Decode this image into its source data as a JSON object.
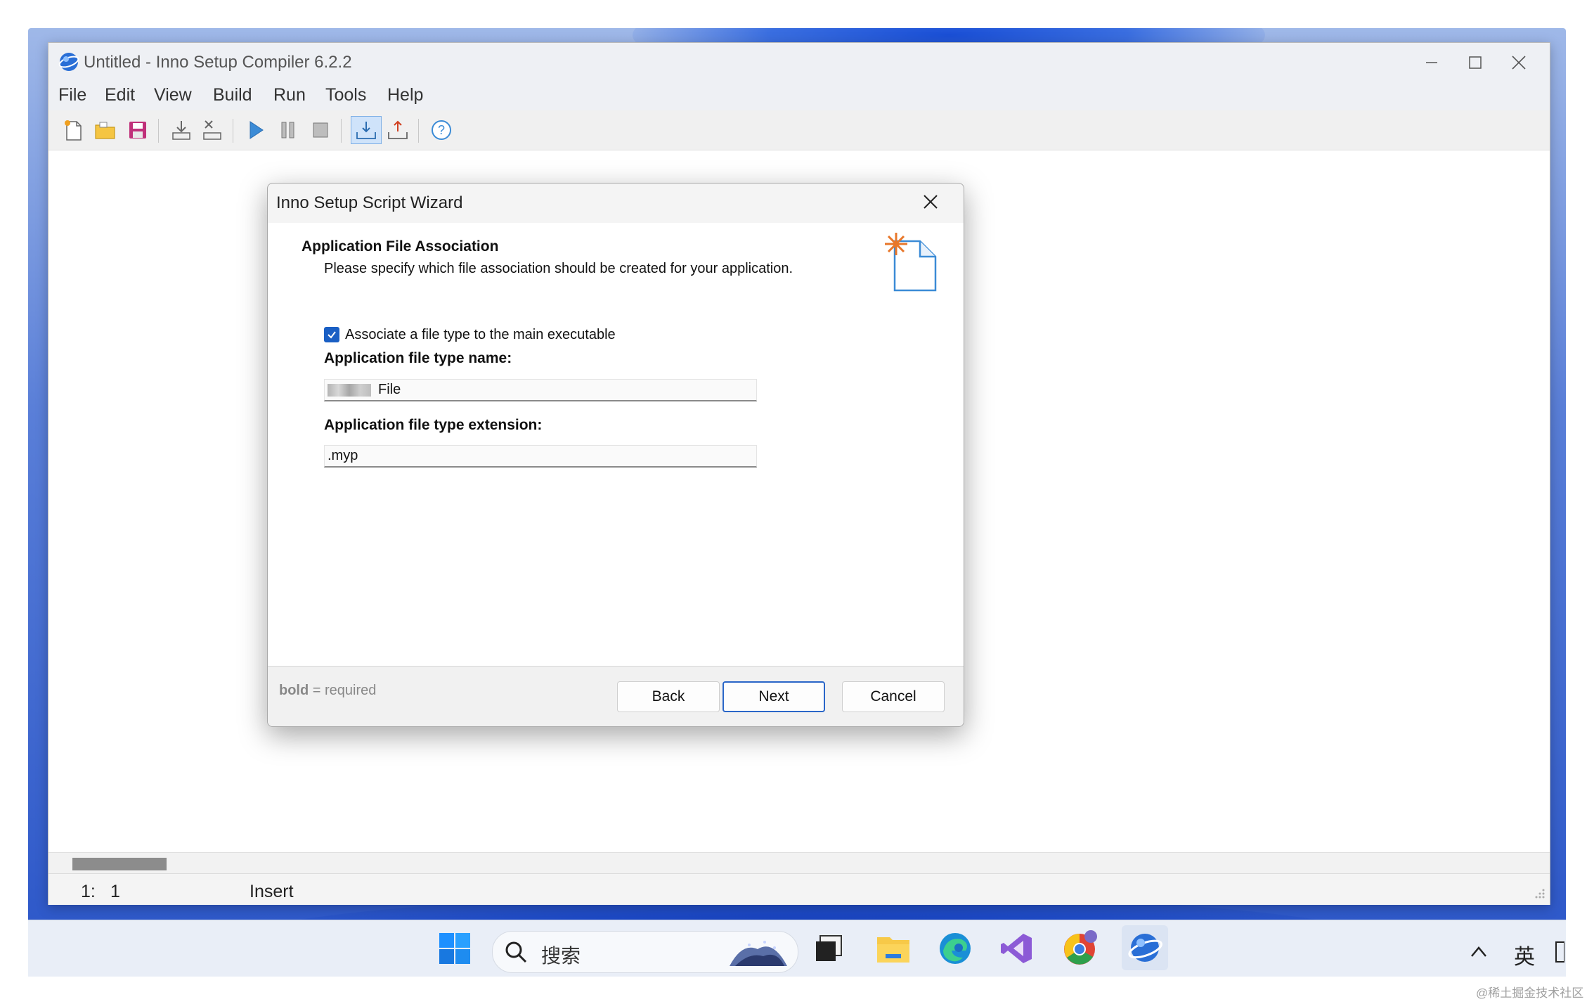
{
  "window": {
    "title": "Untitled - Inno Setup Compiler 6.2.2",
    "controls": [
      "minimize",
      "maximize",
      "close"
    ]
  },
  "menu": [
    "File",
    "Edit",
    "View",
    "Build",
    "Run",
    "Tools",
    "Help"
  ],
  "toolbar": {
    "icons": [
      "new-file-icon",
      "open-folder-icon",
      "save-icon",
      "compile-icon",
      "stop-compile-icon",
      "run-icon",
      "pause-icon",
      "stop-icon",
      "target-setup-icon",
      "target-uninstall-icon",
      "help-icon"
    ]
  },
  "status": {
    "line": "1:",
    "col": "1",
    "mode": "Insert"
  },
  "dialog": {
    "title": "Inno Setup Script Wizard",
    "section_title": "Application File Association",
    "section_subtitle": "Please specify which file association should be created for your application.",
    "checkbox_label": "Associate a file type to the main executable",
    "checkbox_checked": true,
    "field1_label": "Application file type name:",
    "field1_value": "File",
    "field2_label": "Application file type extension:",
    "field2_value": ".myp",
    "required_bold": "bold",
    "required_rest": "= required",
    "back_label": "Back",
    "next_label": "Next",
    "cancel_label": "Cancel"
  },
  "taskbar": {
    "search_placeholder": "搜索",
    "ime": "英",
    "apps": [
      "windows-start-icon",
      "task-view-icon",
      "file-explorer-icon",
      "edge-icon",
      "visual-studio-icon",
      "chrome-icon",
      "inno-setup-icon"
    ]
  },
  "watermark": "@稀土掘金技术社区",
  "colors": {
    "accent": "#1a5fc4",
    "dialog_bg": "#f4f4f4",
    "titlebar_bg": "#eef0f4"
  }
}
